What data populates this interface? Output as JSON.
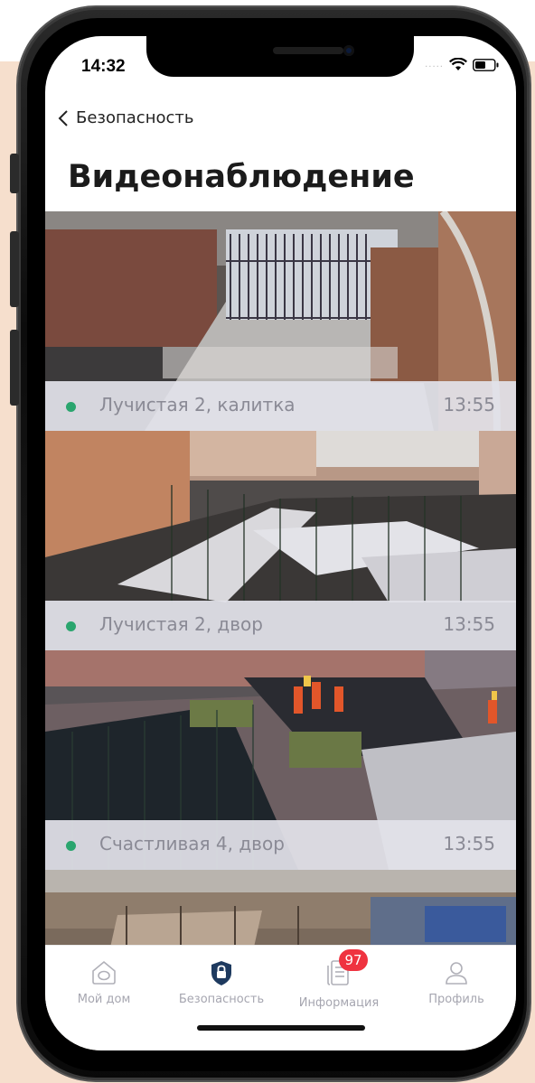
{
  "status_bar": {
    "time": "14:32",
    "signal": "....."
  },
  "nav": {
    "back_label": "Безопасность"
  },
  "page": {
    "title": "Видеонаблюдение"
  },
  "cameras": [
    {
      "name": "Лучистая 2, калитка",
      "time": "13:55",
      "online": true
    },
    {
      "name": "Лучистая 2, двор",
      "time": "13:55",
      "online": true
    },
    {
      "name": "Счастливая 4, двор",
      "time": "13:55",
      "online": true
    },
    {
      "name": "",
      "time": "",
      "online": true
    }
  ],
  "tabs": [
    {
      "label": "Мой дом",
      "icon": "house-icon",
      "active": false
    },
    {
      "label": "Безопасность",
      "icon": "shield-lock-icon",
      "active": true
    },
    {
      "label": "Информация",
      "icon": "document-icon",
      "active": false,
      "badge": "97"
    },
    {
      "label": "Профиль",
      "icon": "person-icon",
      "active": false
    }
  ],
  "colors": {
    "accent": "#1e3a5f",
    "online": "#2aa56e",
    "badge": "#ef3340",
    "background": "#f6dfcd"
  }
}
